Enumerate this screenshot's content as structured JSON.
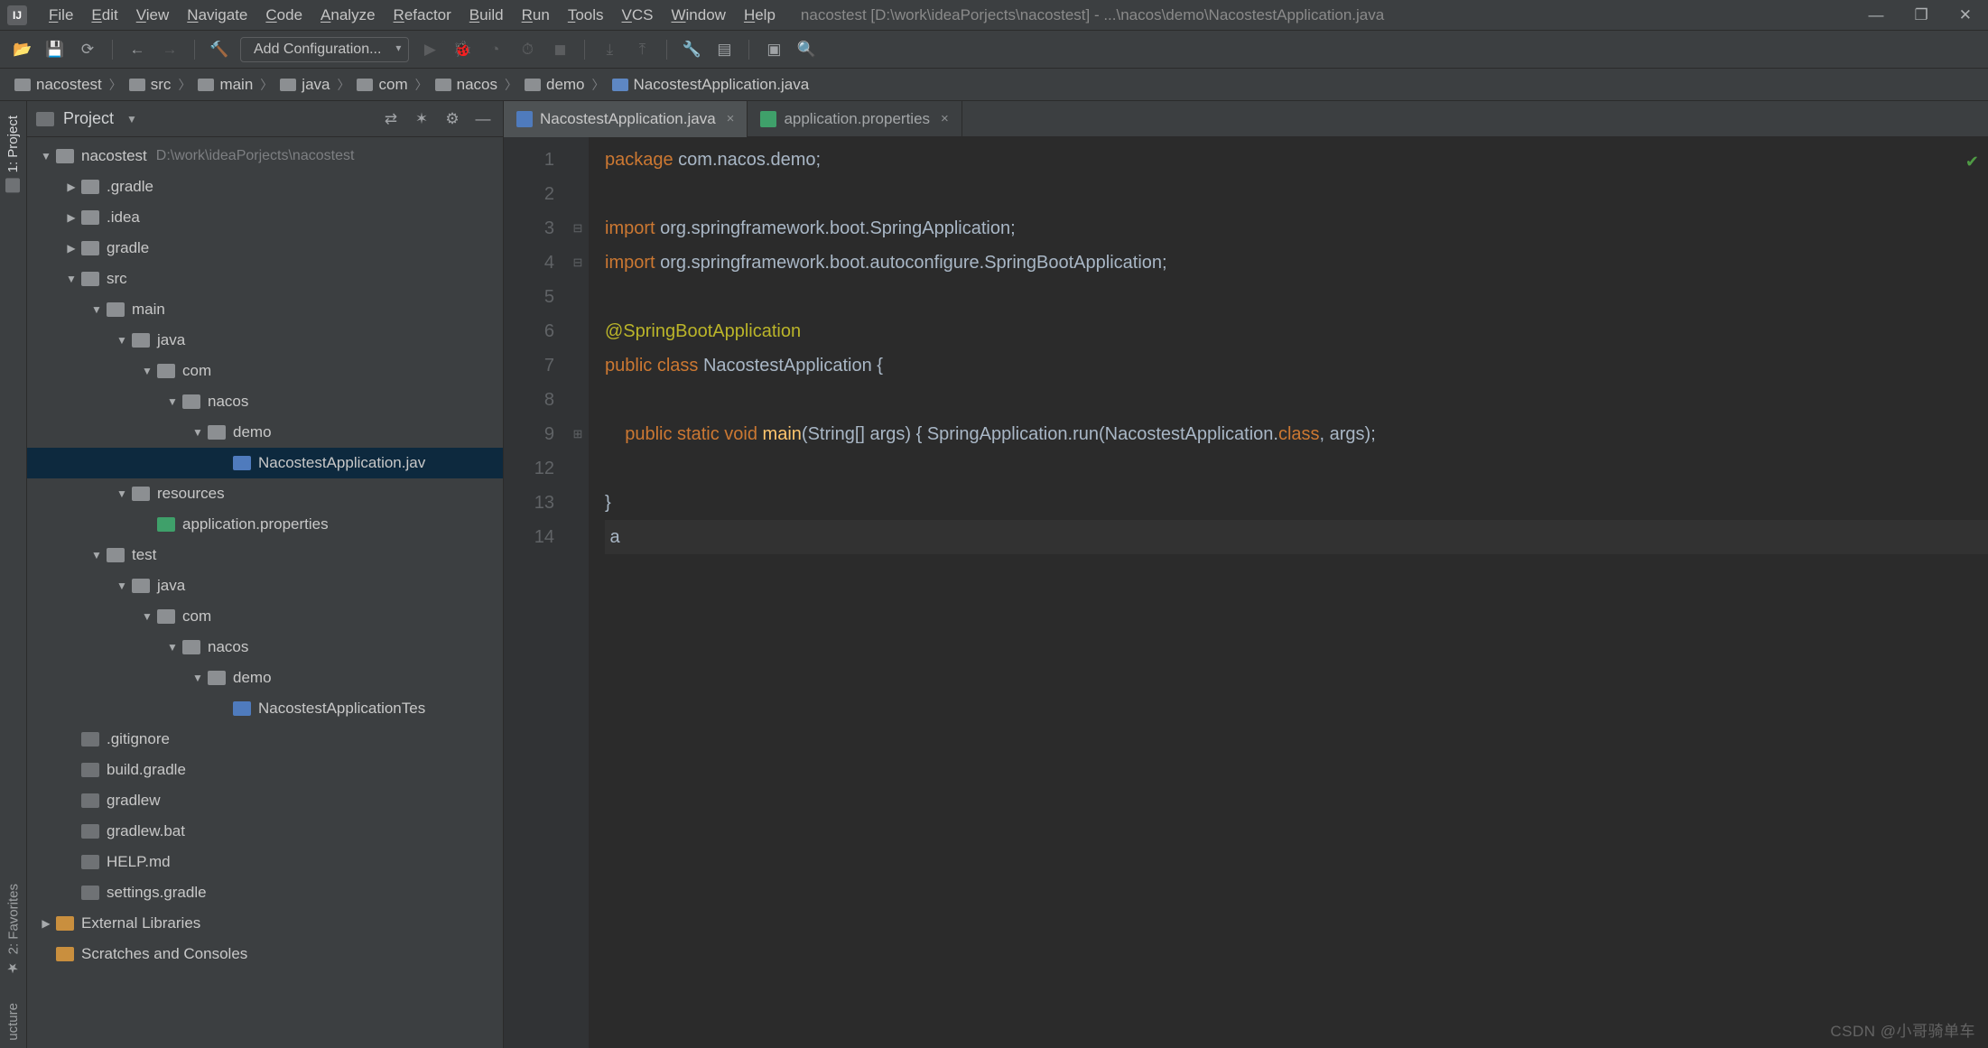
{
  "menubar": {
    "items": [
      "File",
      "Edit",
      "View",
      "Navigate",
      "Code",
      "Analyze",
      "Refactor",
      "Build",
      "Run",
      "Tools",
      "VCS",
      "Window",
      "Help"
    ],
    "title": "nacostest [D:\\work\\ideaPorjects\\nacostest] - ...\\nacos\\demo\\NacostestApplication.java"
  },
  "toolbar": {
    "add_configuration": "Add Configuration..."
  },
  "breadcrumbs": [
    {
      "label": "nacostest",
      "kind": "folder"
    },
    {
      "label": "src",
      "kind": "folder"
    },
    {
      "label": "main",
      "kind": "folder"
    },
    {
      "label": "java",
      "kind": "folder"
    },
    {
      "label": "com",
      "kind": "folder"
    },
    {
      "label": "nacos",
      "kind": "folder"
    },
    {
      "label": "demo",
      "kind": "folder"
    },
    {
      "label": "NacostestApplication.java",
      "kind": "java"
    }
  ],
  "left_tabs": {
    "project": "1: Project",
    "favorites": "2: Favorites",
    "structure": "ucture"
  },
  "project_panel": {
    "title": "Project"
  },
  "tree": [
    {
      "d": 0,
      "a": "▼",
      "i": "folder",
      "t": "nacostest",
      "p": "D:\\work\\ideaPorjects\\nacostest"
    },
    {
      "d": 1,
      "a": "▶",
      "i": "folder",
      "t": ".gradle"
    },
    {
      "d": 1,
      "a": "▶",
      "i": "folder",
      "t": ".idea"
    },
    {
      "d": 1,
      "a": "▶",
      "i": "folder",
      "t": "gradle"
    },
    {
      "d": 1,
      "a": "▼",
      "i": "folder",
      "t": "src"
    },
    {
      "d": 2,
      "a": "▼",
      "i": "folder",
      "t": "main"
    },
    {
      "d": 3,
      "a": "▼",
      "i": "folder",
      "t": "java"
    },
    {
      "d": 4,
      "a": "▼",
      "i": "folder",
      "t": "com"
    },
    {
      "d": 5,
      "a": "▼",
      "i": "folder",
      "t": "nacos"
    },
    {
      "d": 6,
      "a": "▼",
      "i": "folder",
      "t": "demo"
    },
    {
      "d": 7,
      "a": "",
      "i": "java",
      "t": "NacostestApplication.jav",
      "sel": true
    },
    {
      "d": 3,
      "a": "▼",
      "i": "folder",
      "t": "resources"
    },
    {
      "d": 4,
      "a": "",
      "i": "prop",
      "t": "application.properties"
    },
    {
      "d": 2,
      "a": "▼",
      "i": "folder",
      "t": "test"
    },
    {
      "d": 3,
      "a": "▼",
      "i": "folder",
      "t": "java"
    },
    {
      "d": 4,
      "a": "▼",
      "i": "folder",
      "t": "com"
    },
    {
      "d": 5,
      "a": "▼",
      "i": "folder",
      "t": "nacos"
    },
    {
      "d": 6,
      "a": "▼",
      "i": "folder",
      "t": "demo"
    },
    {
      "d": 7,
      "a": "",
      "i": "java",
      "t": "NacostestApplicationTes"
    },
    {
      "d": 1,
      "a": "",
      "i": "file",
      "t": ".gitignore"
    },
    {
      "d": 1,
      "a": "",
      "i": "file",
      "t": "build.gradle"
    },
    {
      "d": 1,
      "a": "",
      "i": "file",
      "t": "gradlew"
    },
    {
      "d": 1,
      "a": "",
      "i": "file",
      "t": "gradlew.bat"
    },
    {
      "d": 1,
      "a": "",
      "i": "file",
      "t": "HELP.md"
    },
    {
      "d": 1,
      "a": "",
      "i": "file",
      "t": "settings.gradle"
    },
    {
      "d": 0,
      "a": "▶",
      "i": "lib",
      "t": "External Libraries"
    },
    {
      "d": 0,
      "a": "",
      "i": "lib",
      "t": "Scratches and Consoles"
    }
  ],
  "editor_tabs": [
    {
      "label": "NacostestApplication.java",
      "icon": "java",
      "active": true
    },
    {
      "label": "application.properties",
      "icon": "prop",
      "active": false
    }
  ],
  "editor": {
    "line_numbers": [
      1,
      2,
      3,
      4,
      5,
      6,
      7,
      8,
      9,
      12,
      13,
      14
    ],
    "fold": [
      "",
      "",
      "⊟",
      "⊟",
      "",
      "",
      "",
      "",
      "⊞",
      "",
      "",
      ""
    ],
    "lines": [
      {
        "html": "<span class='kw'>package</span> com.nacos.demo;"
      },
      {
        "html": ""
      },
      {
        "html": "<span class='kw'>import</span> org.springframework.boot.SpringApplication;"
      },
      {
        "html": "<span class='kw'>import</span> org.springframework.boot.autoconfigure.SpringBootApplication;"
      },
      {
        "html": ""
      },
      {
        "html": "<span class='an'>@SpringBootApplication</span>"
      },
      {
        "html": "<span class='kw'>public class</span> NacostestApplication {"
      },
      {
        "html": ""
      },
      {
        "html": "    <span class='kw'>public static void</span> <span class='mth'>main</span>(String[] args) { SpringApplication.<span>run</span>(NacostestApplication.<span class='kw'>class</span>, args);"
      },
      {
        "html": ""
      },
      {
        "html": "}"
      },
      {
        "html": " a",
        "hl": true
      }
    ]
  },
  "watermark": "CSDN @小哥骑单车"
}
